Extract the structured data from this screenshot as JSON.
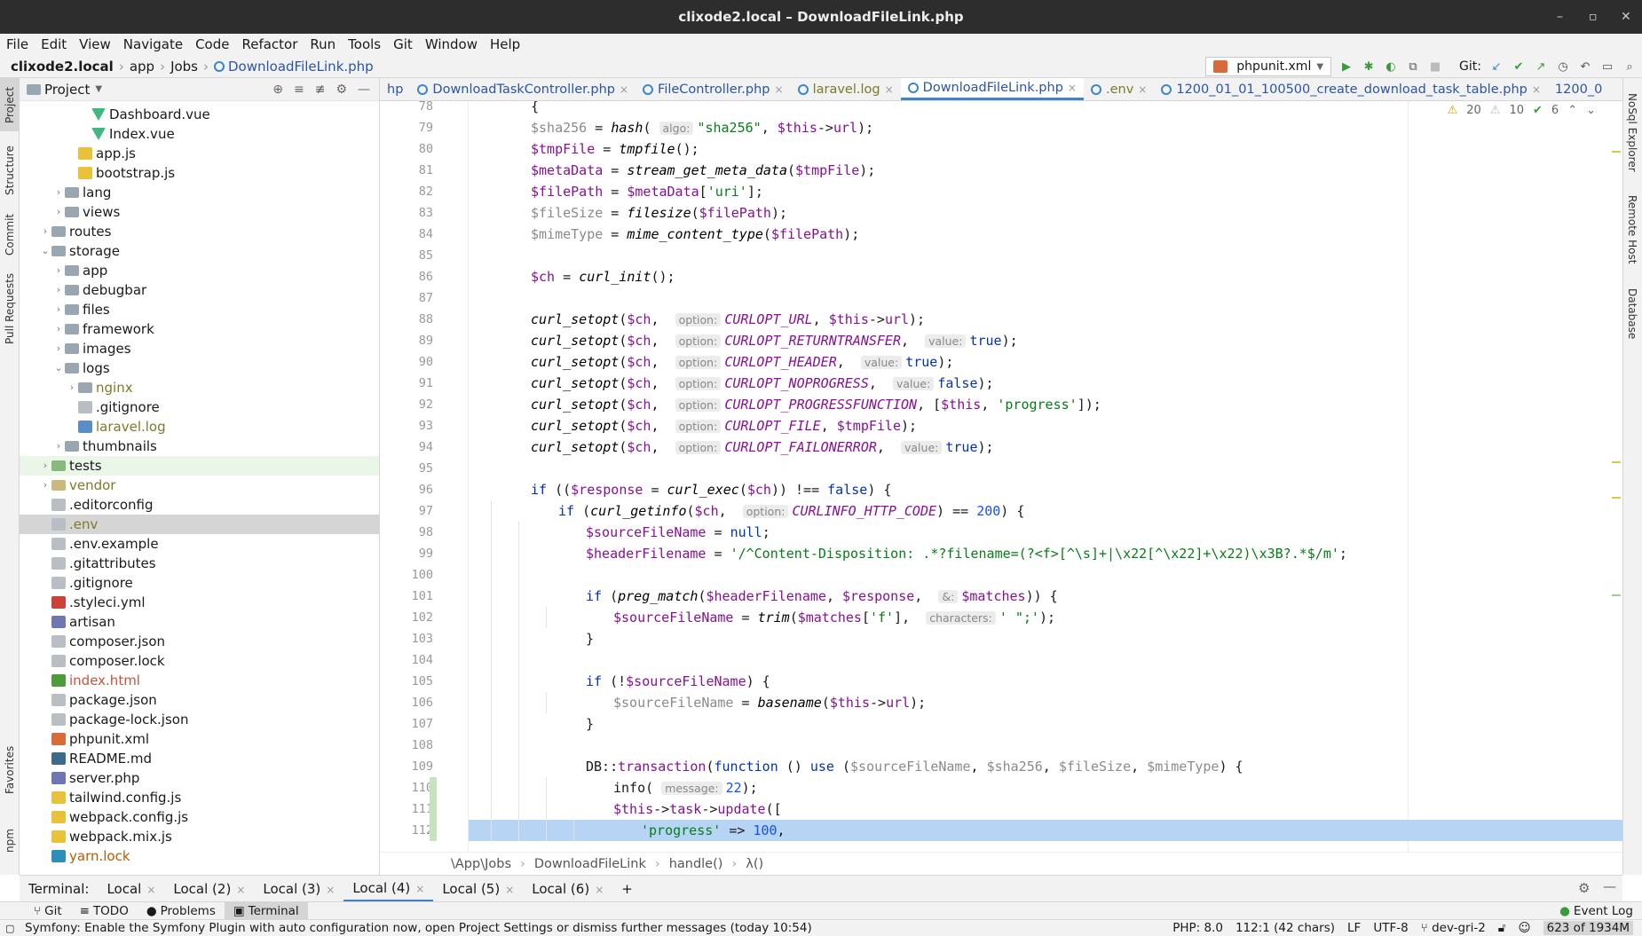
{
  "window": {
    "title": "clixode2.local – DownloadFileLink.php"
  },
  "menu": [
    "File",
    "Edit",
    "View",
    "Navigate",
    "Code",
    "Refactor",
    "Run",
    "Tools",
    "Git",
    "Window",
    "Help"
  ],
  "breadcrumb": [
    "clixode2.local",
    "app",
    "Jobs",
    "DownloadFileLink.php"
  ],
  "toolbar": {
    "run_config": "phpunit.xml",
    "git_label": "Git:"
  },
  "project": {
    "title": "Project",
    "tree": [
      {
        "label": "Dashboard.vue",
        "depth": 5,
        "icon": "vue"
      },
      {
        "label": "Index.vue",
        "depth": 5,
        "icon": "vue"
      },
      {
        "label": "app.js",
        "depth": 4,
        "icon": "js"
      },
      {
        "label": "bootstrap.js",
        "depth": 4,
        "icon": "js"
      },
      {
        "label": "lang",
        "depth": 3,
        "icon": "folder",
        "chev": "›"
      },
      {
        "label": "views",
        "depth": 3,
        "icon": "folder",
        "chev": "›"
      },
      {
        "label": "routes",
        "depth": 2,
        "icon": "folder",
        "chev": "›"
      },
      {
        "label": "storage",
        "depth": 2,
        "icon": "folder",
        "chev": "⌄"
      },
      {
        "label": "app",
        "depth": 3,
        "icon": "folder",
        "chev": "›"
      },
      {
        "label": "debugbar",
        "depth": 3,
        "icon": "folder",
        "chev": "›"
      },
      {
        "label": "files",
        "depth": 3,
        "icon": "folder",
        "chev": "›"
      },
      {
        "label": "framework",
        "depth": 3,
        "icon": "folder",
        "chev": "›"
      },
      {
        "label": "images",
        "depth": 3,
        "icon": "folder",
        "chev": "›"
      },
      {
        "label": "logs",
        "depth": 3,
        "icon": "folder",
        "chev": "⌄"
      },
      {
        "label": "nginx",
        "depth": 4,
        "icon": "folder",
        "chev": "›",
        "color": "olive"
      },
      {
        "label": ".gitignore",
        "depth": 4,
        "icon": "gen"
      },
      {
        "label": "laravel.log",
        "depth": 4,
        "icon": "log",
        "color": "olive"
      },
      {
        "label": "thumbnails",
        "depth": 3,
        "icon": "folder",
        "chev": "›"
      },
      {
        "label": "tests",
        "depth": 2,
        "icon": "foldergreen",
        "chev": "›",
        "hl": true
      },
      {
        "label": "vendor",
        "depth": 2,
        "icon": "foldervendor",
        "chev": "›",
        "color": "olive"
      },
      {
        "label": ".editorconfig",
        "depth": 2,
        "icon": "gen"
      },
      {
        "label": ".env",
        "depth": 2,
        "icon": "gen",
        "color": "olive",
        "sel": true
      },
      {
        "label": ".env.example",
        "depth": 2,
        "icon": "gen"
      },
      {
        "label": ".gitattributes",
        "depth": 2,
        "icon": "gen"
      },
      {
        "label": ".gitignore",
        "depth": 2,
        "icon": "gen"
      },
      {
        "label": ".styleci.yml",
        "depth": 2,
        "icon": "yml"
      },
      {
        "label": "artisan",
        "depth": 2,
        "icon": "php"
      },
      {
        "label": "composer.json",
        "depth": 2,
        "icon": "gen"
      },
      {
        "label": "composer.lock",
        "depth": 2,
        "icon": "gen"
      },
      {
        "label": "index.html",
        "depth": 2,
        "icon": "html",
        "color": "red"
      },
      {
        "label": "package.json",
        "depth": 2,
        "icon": "gen"
      },
      {
        "label": "package-lock.json",
        "depth": 2,
        "icon": "gen"
      },
      {
        "label": "phpunit.xml",
        "depth": 2,
        "icon": "xml"
      },
      {
        "label": "README.md",
        "depth": 2,
        "icon": "md"
      },
      {
        "label": "server.php",
        "depth": 2,
        "icon": "php"
      },
      {
        "label": "tailwind.config.js",
        "depth": 2,
        "icon": "js"
      },
      {
        "label": "webpack.config.js",
        "depth": 2,
        "icon": "js"
      },
      {
        "label": "webpack.mix.js",
        "depth": 2,
        "icon": "js"
      },
      {
        "label": "yarn.lock",
        "depth": 2,
        "icon": "yarn",
        "color": "orange"
      }
    ]
  },
  "tabs": [
    {
      "label": "hp",
      "partial": true
    },
    {
      "label": "DownloadTaskController.php"
    },
    {
      "label": "FileController.php"
    },
    {
      "label": "laravel.log"
    },
    {
      "label": "DownloadFileLink.php",
      "active": true
    },
    {
      "label": ".env"
    },
    {
      "label": "1200_01_01_100500_create_download_task_table.php"
    },
    {
      "label": "1200_0",
      "partial": true
    }
  ],
  "inspections": {
    "errors": "20",
    "warnings": "10",
    "ok": "6"
  },
  "lines": [
    {
      "n": "78",
      "html": "    {",
      "indent": 0
    },
    {
      "n": "79",
      "html": "<span class='vg'>$sha256</span> = <span class='fn'>hash</span>( <span class='hint'>algo:</span><span class='str'>\"sha256\"</span>, <span class='v'>$this</span>-&gt;<span class='v'>url</span>);",
      "indent": 1
    },
    {
      "n": "80",
      "html": "<span class='v'>$tmpFile</span> = <span class='fn'>tmpfile</span>();",
      "indent": 1
    },
    {
      "n": "81",
      "html": "<span class='v'>$metaData</span> = <span class='fn'>stream_get_meta_data</span>(<span class='v'>$tmpFile</span>);",
      "indent": 1
    },
    {
      "n": "82",
      "html": "<span class='v'>$filePath</span> = <span class='v'>$metaData</span>[<span class='str'>'uri'</span>];",
      "indent": 1
    },
    {
      "n": "83",
      "html": "<span class='vg'>$fileSize</span> = <span class='fn'>filesize</span>(<span class='v'>$filePath</span>);",
      "indent": 1
    },
    {
      "n": "84",
      "html": "<span class='vg'>$mimeType</span> = <span class='fn'>mime_content_type</span>(<span class='v'>$filePath</span>);",
      "indent": 1
    },
    {
      "n": "85",
      "html": "",
      "indent": 1
    },
    {
      "n": "86",
      "html": "<span class='v'>$ch</span> = <span class='fn'>curl_init</span>();",
      "indent": 1
    },
    {
      "n": "87",
      "html": "",
      "indent": 1
    },
    {
      "n": "88",
      "html": "<span class='fn'>curl_setopt</span>(<span class='v'>$ch</span>,  <span class='hint'>option:</span><span class='cst'>CURLOPT_URL</span>, <span class='v'>$this</span>-&gt;<span class='v'>url</span>);",
      "indent": 1
    },
    {
      "n": "89",
      "html": "<span class='fn'>curl_setopt</span>(<span class='v'>$ch</span>,  <span class='hint'>option:</span><span class='cst'>CURLOPT_RETURNTRANSFER</span>,  <span class='hint'>value:</span><span class='kw'>true</span>);",
      "indent": 1
    },
    {
      "n": "90",
      "html": "<span class='fn'>curl_setopt</span>(<span class='v'>$ch</span>,  <span class='hint'>option:</span><span class='cst'>CURLOPT_HEADER</span>,  <span class='hint'>value:</span><span class='kw'>true</span>);",
      "indent": 1
    },
    {
      "n": "91",
      "html": "<span class='fn'>curl_setopt</span>(<span class='v'>$ch</span>,  <span class='hint'>option:</span><span class='cst'>CURLOPT_NOPROGRESS</span>,  <span class='hint'>value:</span><span class='kw'>false</span>);",
      "indent": 1
    },
    {
      "n": "92",
      "html": "<span class='fn'>curl_setopt</span>(<span class='v'>$ch</span>,  <span class='hint'>option:</span><span class='cst'>CURLOPT_PROGRESSFUNCTION</span>, [<span class='v'>$this</span>, <span class='str'>'progress'</span>]);",
      "indent": 1
    },
    {
      "n": "93",
      "html": "<span class='fn'>curl_setopt</span>(<span class='v'>$ch</span>,  <span class='hint'>option:</span><span class='cst'>CURLOPT_FILE</span>, <span class='v'>$tmpFile</span>);",
      "indent": 1
    },
    {
      "n": "94",
      "html": "<span class='fn'>curl_setopt</span>(<span class='v'>$ch</span>,  <span class='hint'>option:</span><span class='cst'>CURLOPT_FAILONERROR</span>,  <span class='hint'>value:</span><span class='kw'>true</span>);",
      "indent": 1
    },
    {
      "n": "95",
      "html": "",
      "indent": 1
    },
    {
      "n": "96",
      "html": "<span class='kw'>if</span> ((<span class='v'>$response</span> = <span class='fn'>curl_exec</span>(<span class='v'>$ch</span>)) !== <span class='kw'>false</span>) {",
      "indent": 1
    },
    {
      "n": "97",
      "html": "<span class='kw'>if</span> (<span class='fn'>curl_getinfo</span>(<span class='v'>$ch</span>,  <span class='hint'>option:</span><span class='cst'>CURLINFO_HTTP_CODE</span>) == <span class='num'>200</span>) {",
      "indent": 2
    },
    {
      "n": "98",
      "html": "<span class='v'>$sourceFileName</span> = <span class='kw'>null</span>;",
      "indent": 3
    },
    {
      "n": "99",
      "html": "<span class='v'>$headerFilename</span> = <span class='str'>'/^Content-Disposition: .*?filename=(?&lt;f&gt;[^\\s]+|\\x22[^\\x22]+\\x22)\\x3B?.*$/m'</span>;",
      "indent": 3
    },
    {
      "n": "100",
      "html": "",
      "indent": 3
    },
    {
      "n": "101",
      "html": "<span class='kw'>if</span> (<span class='fn'>preg_match</span>(<span class='v'>$headerFilename</span>, <span class='v'>$response</span>,  <span class='hint'>&amp;:</span><span class='v'>$matches</span>)) {",
      "indent": 3
    },
    {
      "n": "102",
      "html": "<span class='v'>$sourceFileName</span> = <span class='fn'>trim</span>(<span class='v'>$matches</span>[<span class='str'>'f'</span>],  <span class='hint'>characters:</span><span class='str'>' \";'</span>);",
      "indent": 4
    },
    {
      "n": "103",
      "html": "}",
      "indent": 3
    },
    {
      "n": "104",
      "html": "",
      "indent": 3
    },
    {
      "n": "105",
      "html": "<span class='kw'>if</span> (!<span class='v'>$sourceFileName</span>) {",
      "indent": 3
    },
    {
      "n": "106",
      "html": "<span class='vg'>$sourceFileName</span> = <span class='fn'>basename</span>(<span class='v'>$this</span>-&gt;<span class='v'>url</span>);",
      "indent": 4
    },
    {
      "n": "107",
      "html": "}",
      "indent": 3
    },
    {
      "n": "108",
      "html": "",
      "indent": 3
    },
    {
      "n": "109",
      "html": "DB::<span class='v'>transaction</span>(<span class='kw'>function</span> () <span class='kw'>use</span> (<span class='vg'>$sourceFileName</span>, <span class='vg'>$sha256</span>, <span class='vg'>$fileSize</span>, <span class='vg'>$mimeType</span>) {",
      "indent": 3
    },
    {
      "n": "110",
      "html": "info( <span class='hint'>message:</span><span class='num'>22</span>);",
      "indent": 4,
      "mod": true
    },
    {
      "n": "111",
      "html": "<span class='v'>$this</span>-&gt;<span class='v'>task</span>-&gt;<span class='v'>update</span>([",
      "indent": 4,
      "mod": true
    },
    {
      "n": "112",
      "html": "<span class='str'>'progress'</span> =&gt; <span class='num'>100</span>,",
      "indent": 5,
      "cur": true,
      "mod": true
    }
  ],
  "editor_breadcrumb": [
    "\\App\\Jobs",
    "DownloadFileLink",
    "handle()",
    "λ()"
  ],
  "terminal": {
    "label": "Terminal:",
    "tabs": [
      "Local",
      "Local (2)",
      "Local (3)",
      "Local (4)",
      "Local (5)",
      "Local (6)"
    ],
    "active": 3
  },
  "toolwindows": [
    "Git",
    "TODO",
    "Problems",
    "Terminal"
  ],
  "event_log": "Event Log",
  "left_tabs": [
    "Project",
    "Structure",
    "Commit",
    "Pull Requests",
    "Favorites",
    "npm"
  ],
  "right_tabs": [
    "NoSql Explorer",
    "Remote Host",
    "Database"
  ],
  "status": {
    "message": "Symfony: Enable the Symfony Plugin with auto configuration now, open Project Settings or dismiss further messages (today 10:54)",
    "php": "PHP: 8.0",
    "position": "112:1 (42 chars)",
    "line_sep": "LF",
    "encoding": "UTF-8",
    "branch": "dev-gri-2",
    "memory": "623 of 1934M"
  }
}
